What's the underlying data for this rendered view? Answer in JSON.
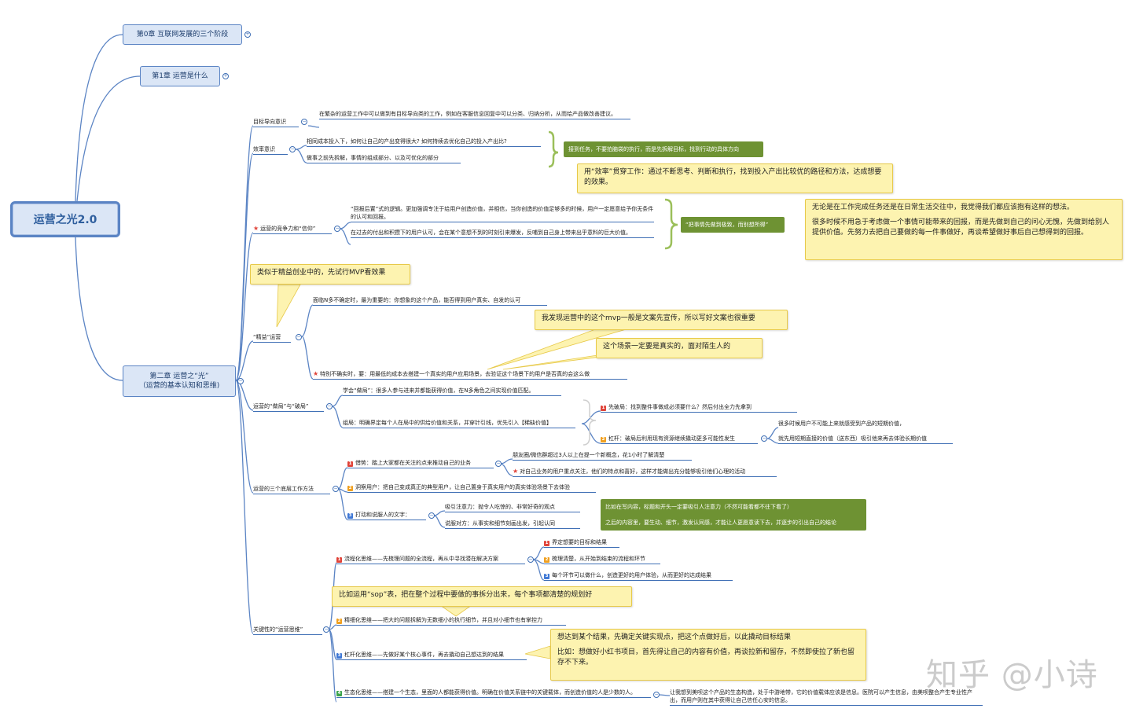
{
  "root": "运营之光2.0",
  "chapters": {
    "ch0": "第0章 互联网发展的三个阶段",
    "ch1": "第1章 运营是什么",
    "ch2_line1": "第二章 运营之“光”",
    "ch2_line2": "（运营的基本认知和思维)"
  },
  "toggle_plus": "+",
  "toggle_minus": "−",
  "topics": {
    "goal": {
      "label": "目标导向意识",
      "detail": "在繁杂的运营工作中可以做到有目标导向类的工作，例如在客服信息回复中可以分类、归纳分析，从而给产品做改善建议。"
    },
    "efficiency": {
      "label": "效率意识",
      "item1": "相同成本投入下，如何让自己的产出变得很大? 如何持续去优化自己的投入产出比?",
      "item2": "做事之前先拆解，事情的组成部分、以及可优化的部分",
      "green_note": "接到任务，不要拍脑袋的执行，而是先拆解目标，找到行动的具体方向",
      "yellow_note": "用“效率”贯穿工作：通过不断思考、判断和执行，找到投入产出比较优的路径和方法，达成想要的效果。"
    },
    "faith": {
      "label": "运营的竞争力和“信仰”",
      "item1": "“回报后置”式的逻辑。更加强调专注于给用户创造价值，并相信，当你创造的价值足够多的时候，用户一定愿意给予你无条件的认可和回报。",
      "item2": "在过去的付出和积攒下的用户认可，会在某个意想不到的时刻引来爆发，反哺到自己身上带来出乎意料的巨大价值。",
      "green_note": "“把事情先做到极致，而别想所得”",
      "yellow_note_p1": "无论是在工作完成任务还是在日常生活交往中，我觉得我们都应该抱有这样的想法。",
      "yellow_note_p2": "很多时候不用急于考虑做一个事情可能带来的回报，而是先做到自己的问心无愧，先做到给别人提供价值。先努力去把自己要做的每一件事做好，再谈希望做好事后自己想得到的回报。"
    },
    "lean": {
      "label": "“精益”运营",
      "item1": "面临N多不确定时，最为重要的：你想象的这个产品，能否得到用户真实、自发的认可",
      "item2": "特别不确实时，要：用最低的成本去搭建一个真实的用户应用场景，去验证这个场景下的用户是否真的会这么做",
      "note_mvp": "类似于精益创业中的，先试行MVP看效果",
      "note_copy": "我发现运营中的这个mvp一般是文案先宣传，所以写好文案也很重要",
      "note_scene": "这个场景一定要是真实的，面对陌生人的"
    },
    "game": {
      "label": "运营的“做局”与“破局”",
      "item1": "学会“做局”：很多人参与进来并都能获得价值，在N多角色之间实现价值匹配。",
      "item2": "组局：明确界定每个人在局中的供给价值和关系，并穿针引线，优先引入【稀缺价值】",
      "sub1": "先破局：找到整件事做成必须要什么？然后付出全力先拿到",
      "sub2": "杠杆：破局后利用现有资源继续撬动更多可能性发生",
      "sub2a": "很多时候用户不可能上来就感受到产品的短期价值，",
      "sub2b": "就先用短期直接的价值（送东西）吸引他来再去体验长期价值"
    },
    "base": {
      "label": "运营的三个底层工作方法",
      "item1": "借势：踏上大家都在关注的点来推动自己的业务",
      "item1a": "朋友圈/微信群超过3人以上在提一个新概念，花1小时了解清楚",
      "item1b": "对自己业务的用户重点关注，他们的特点和喜好，这样才能做出充分能够吸引他们心理的活动",
      "item2": "洞察用户：把自己变成真正的典型用户，让自己置身于真实用户的真实体验场景下去体验",
      "item3": "打动和说服人的文字：",
      "item3a": "吸引注意力：抛令人吃惊的、非常好奇的观点",
      "item3b": "说服对方：从事实和细节刻画出发，引起认同",
      "green_p1": "比如在写内容，标题和开头一定要吸引人注意力（不然可能看都不往下看了）",
      "green_p2": "之后的内容里，要生动、细节，激发认同感，才能让人更愿意读下去，并逐步的引出自己的结论"
    },
    "thinking": {
      "label": "关键性的“运营思维”",
      "flow": "流程化思维——先梳理问题的全流程，再从中寻找潜在解决方案",
      "flow1": "界定想要的目标和结果",
      "flow2": "梳理清楚，从开始到结束的流程和环节",
      "flow3": "每个环节可以做什么，创造更好的用户体验，从而更好的达成结果",
      "fine": "精细化思维——把大的问题拆解为无数细小的执行细节，并且对小细节也有掌控力",
      "note_sop": "比如运用“sop”表，把在整个过程中要做的事拆分出来，每个事项都清楚的规划好",
      "lever": "杠杆化思维——先做好某个核心事件，再去撬动自己想达到的结果",
      "lever_p1": "想达到某个结果，先确定关键实现点，把这个点做好后，以此撬动目标结果",
      "lever_p2": "比如：想做好小红书项目，首先得让自己的内容有价值，再谈拉新和留存，不然即使拉了新也留存不下来。",
      "eco": "生态化思维——搭建一个生态，里面的人都能获得价值。明确在价值关系链中的关键载体，而创造价值的人是少数的人。",
      "eco_detail": "让我想到美呗这个产品的生态构造，处于中游地带，它的价值载体应该是信息。医院可以产生信息，由美呗整合产生专业性产出，而用户则在其中获得让自己信任心安的信息。"
    },
    "badges": {
      "n1": "1",
      "n2": "2",
      "n3": "3",
      "n4": "4"
    },
    "star": "★"
  },
  "watermark": "知乎 @小诗"
}
